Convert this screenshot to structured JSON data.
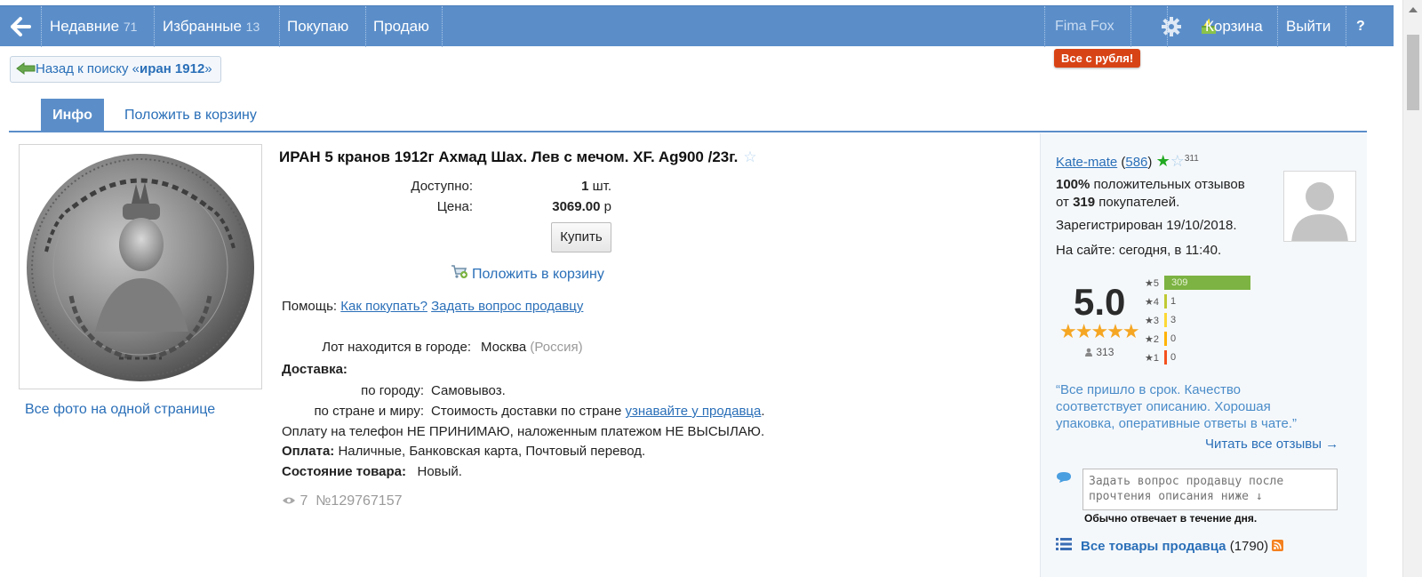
{
  "nav": {
    "recent_label": "Недавние",
    "recent_count": "71",
    "favorites_label": "Избранные",
    "favorites_count": "13",
    "buying_label": "Покупаю",
    "selling_label": "Продаю",
    "user_name": "Fima Fox",
    "cart_label": "Корзина",
    "logout_label": "Выйти",
    "help_label": "?",
    "promo": "Все с рубля!"
  },
  "back": {
    "prefix": "Назад к поиску «",
    "query": "иран 1912",
    "suffix": "»"
  },
  "tabs": {
    "info": "Инфо",
    "add_to_cart": "Положить в корзину"
  },
  "gallery": {
    "all_photos_link": "Все фото на одной странице"
  },
  "lot": {
    "title": "ИРАН 5 кранов 1912г Ахмад Шах. Лев с мечом. XF. Ag900 /23г.",
    "available_label": "Доступно:",
    "available_qty": "1",
    "available_unit": "шт.",
    "price_label": "Цена:",
    "price_value": "3069.00",
    "price_currency": "р",
    "buy_button": "Купить",
    "add_to_cart": "Положить в корзину",
    "help_label": "Помощь:",
    "help_how_to_buy": "Как покупать?",
    "help_ask_seller": "Задать вопрос продавцу",
    "city_label": "Лот находится в городе:",
    "city": "Москва",
    "country": "(Россия)",
    "delivery_label": "Доставка:",
    "delivery_city_label": "по городу:",
    "delivery_city_value": "Самовывоз.",
    "delivery_world_label": "по стране и миру:",
    "delivery_world_value": "Стоимость доставки по стране",
    "delivery_world_link": "узнавайте у продавца",
    "delivery_world_end": ".",
    "payment_note": "Оплату на телефон НЕ ПРИНИМАЮ, наложенным платежом НЕ ВЫСЫЛАЮ.",
    "payment_label": "Оплата:",
    "payment_value": "Наличные, Банковская карта, Почтовый перевод.",
    "condition_label": "Состояние товара:",
    "condition_value": "Новый.",
    "views": "7",
    "lot_number": "№129767157"
  },
  "seller": {
    "name": "Kate-mate",
    "rating_count": "586",
    "stars_extra": "311",
    "positive_pct": "100%",
    "positive_text": "положительных отзывов",
    "from_text": "от",
    "buyers_count": "319",
    "buyers_text": "покупателей.",
    "registered": "Зарегистрирован 19/10/2018.",
    "online": "На сайте: сегодня, в 11:40.",
    "score": "5.0",
    "stars": "★★★★★",
    "reviews_total": "313",
    "breakdown": [
      {
        "stars": "5",
        "count": "309",
        "color": "#7cb342"
      },
      {
        "stars": "4",
        "count": "1",
        "color": "#c0ca33"
      },
      {
        "stars": "3",
        "count": "3",
        "color": "#fdd835"
      },
      {
        "stars": "2",
        "count": "0",
        "color": "#ffb300"
      },
      {
        "stars": "1",
        "count": "0",
        "color": "#f4511e"
      }
    ],
    "quote": "“Все пришло в срок. Качество соответствует описанию. Хорошая упаковка, оперативные ответы в чате.”",
    "read_all": "Читать все отзывы →",
    "ask_placeholder": "Задать вопрос продавцу после прочтения описания ниже ↓",
    "reply_time": "Обычно отвечает в течение дня.",
    "all_goods_label": "Все товары продавца",
    "all_goods_count": "(1790)"
  },
  "colors": {
    "nav_bg": "#5b8ec9",
    "link": "#2a6fb8",
    "promo": "#d84315",
    "star_green": "#22aa22",
    "star_gold": "#f5a623"
  }
}
